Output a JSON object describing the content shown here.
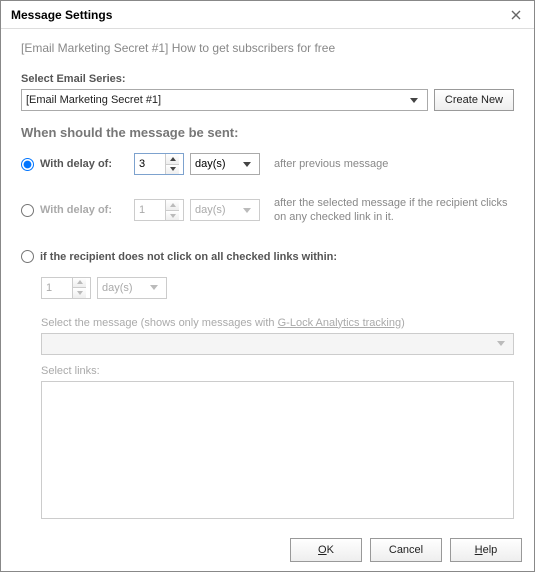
{
  "dialog": {
    "title": "Message Settings",
    "subtitle": "[Email Marketing Secret #1] How to get subscribers for free"
  },
  "series": {
    "label": "Select Email Series:",
    "selected": "[Email Marketing Secret #1]",
    "create_new": "Create New"
  },
  "schedule": {
    "heading": "When should the message be sent:",
    "option1": {
      "label": "With delay of:",
      "value": "3",
      "unit": "day(s)",
      "desc": "after previous message",
      "selected": true
    },
    "option2": {
      "label": "With delay of:",
      "value": "1",
      "unit": "day(s)",
      "desc": "after the selected message if the recipient clicks on any checked link in it.",
      "selected": false
    },
    "option3": {
      "label": "if the recipient does not click on all checked links within:",
      "value": "1",
      "unit": "day(s)",
      "selected": false,
      "select_message_prefix": "Select the message (shows only messages with ",
      "select_message_link": "G-Lock Analytics tracking",
      "select_message_suffix": ")",
      "select_links": "Select links:"
    }
  },
  "footer": {
    "ok": "OK",
    "cancel": "Cancel",
    "help": "Help"
  }
}
